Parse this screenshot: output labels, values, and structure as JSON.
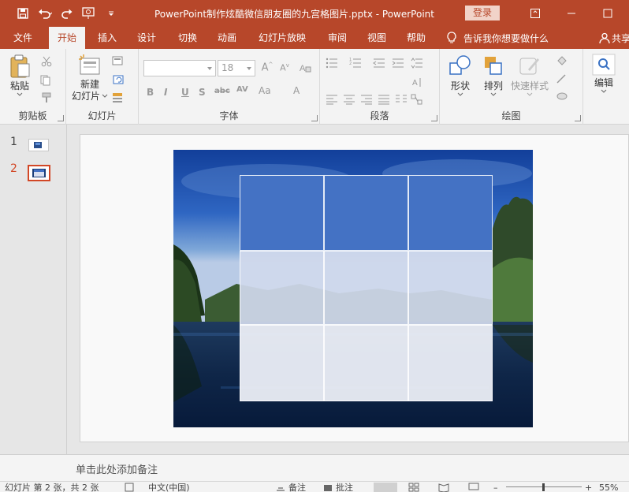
{
  "app": {
    "title": "PowerPoint制作炫酷微信朋友圈的九宫格图片.pptx  -  PowerPoint",
    "login_label": "登录"
  },
  "tabs": [
    "文件",
    "开始",
    "插入",
    "设计",
    "切换",
    "动画",
    "幻灯片放映",
    "审阅",
    "视图",
    "帮助"
  ],
  "tell_me": "告诉我你想要做什么",
  "share_label": "共享",
  "ribbon": {
    "clipboard": {
      "paste": "粘贴",
      "group": "剪贴板"
    },
    "slides": {
      "new_slide_line1": "新建",
      "new_slide_line2": "幻灯片",
      "group": "幻灯片"
    },
    "font": {
      "font_name": "",
      "font_size": "18",
      "group": "字体"
    },
    "paragraph": {
      "group": "段落"
    },
    "drawing": {
      "shapes": "形状",
      "arrange": "排列",
      "quick_styles": "快速样式",
      "group": "绘图"
    },
    "editing": {
      "label": "编辑"
    }
  },
  "slides": {
    "numbers": [
      "1",
      "2"
    ],
    "selected": 2
  },
  "notes_placeholder": "单击此处添加备注",
  "status": {
    "slide_info": "幻灯片 第 2 张，共 2 张",
    "language": "中文(中国)",
    "notes_btn": "备注",
    "comments_btn": "批注",
    "zoom": "55%"
  },
  "colors": {
    "accent": "#b7472a",
    "grid_top_row": "#4472c4"
  }
}
